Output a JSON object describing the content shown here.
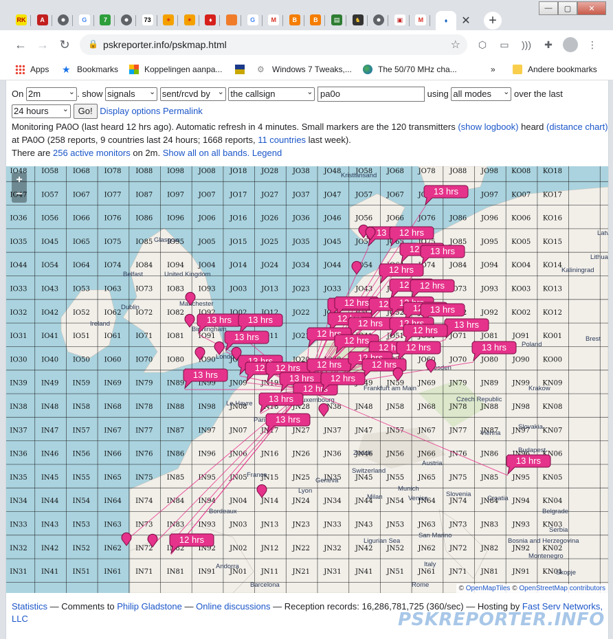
{
  "browser": {
    "url": "pskreporter.info/pskmap.html",
    "tabs": [
      {
        "icon": "rk-icon",
        "text": "RK",
        "color": "#f5e400",
        "fg": "#b00"
      },
      {
        "icon": "acrobat-icon",
        "text": "A",
        "color": "#c21f1f",
        "fg": "#fff"
      },
      {
        "icon": "globe-icon",
        "text": "",
        "color": "#5f6368",
        "fg": "#fff"
      },
      {
        "icon": "google-icon",
        "text": "G",
        "color": "#ffffff",
        "fg": "#4285f4"
      },
      {
        "icon": "seven-icon",
        "text": "7",
        "color": "#2e9e3a",
        "fg": "#fff"
      },
      {
        "icon": "globe-icon",
        "text": "",
        "color": "#5f6368",
        "fg": "#fff"
      },
      {
        "icon": "seventythree-icon",
        "text": "73",
        "color": "#ffffff",
        "fg": "#000"
      },
      {
        "icon": "joomla-icon",
        "text": "✶",
        "color": "#f4a100",
        "fg": "#d6201c"
      },
      {
        "icon": "joomla-icon",
        "text": "✶",
        "color": "#f4a100",
        "fg": "#d6201c"
      },
      {
        "icon": "antenna-icon",
        "text": "♦",
        "color": "#d6201c",
        "fg": "#fff"
      },
      {
        "icon": "orange-circle-icon",
        "text": "",
        "color": "#f07c2a",
        "fg": "#fff"
      },
      {
        "icon": "google-icon",
        "text": "G",
        "color": "#ffffff",
        "fg": "#4285f4"
      },
      {
        "icon": "gmail-icon",
        "text": "M",
        "color": "#ffffff",
        "fg": "#d93025"
      },
      {
        "icon": "blogger-icon",
        "text": "B",
        "color": "#f57d00",
        "fg": "#fff"
      },
      {
        "icon": "blogger-icon",
        "text": "B",
        "color": "#f57d00",
        "fg": "#fff"
      },
      {
        "icon": "radio-icon",
        "text": "▤",
        "color": "#2e7d32",
        "fg": "#fff"
      },
      {
        "icon": "shield-icon",
        "text": "♞",
        "color": "#333333",
        "fg": "#f4c430"
      },
      {
        "icon": "globe-icon",
        "text": "",
        "color": "#5f6368",
        "fg": "#fff"
      },
      {
        "icon": "qsl-icon",
        "text": "▣",
        "color": "#ffffff",
        "fg": "#c62828"
      },
      {
        "icon": "gmail-icon",
        "text": "M",
        "color": "#ffffff",
        "fg": "#d93025"
      },
      {
        "icon": "pskreporter-icon",
        "text": "♦",
        "color": "#ffffff",
        "fg": "#1565c0"
      }
    ],
    "bookmarks": [
      {
        "label": "Apps",
        "icon": "apps-grid-icon"
      },
      {
        "label": "Bookmarks",
        "icon": "star-icon"
      },
      {
        "label": "Koppelingen aanpa...",
        "icon": "windows-icon"
      },
      {
        "label": "",
        "icon": "flag-icon"
      },
      {
        "label": "Windows 7 Tweaks,...",
        "icon": "tweak-icon"
      },
      {
        "label": "The 50/70 MHz cha...",
        "icon": "earth-icon"
      },
      {
        "label": "Andere bookmarks",
        "icon": "folder-icon"
      }
    ],
    "bookmarks_more": "»"
  },
  "controls": {
    "on_label": "On",
    "band": "2m",
    "show_label": ". show",
    "what": "signals",
    "direction": "sent/rcvd by",
    "target_type": "the callsign",
    "callsign": "pa0o",
    "using_label": "using",
    "mode": "all modes",
    "over_label": "over the last",
    "period": "24 hours",
    "go": "Go!",
    "display_options": "Display options",
    "permalink": "Permalink"
  },
  "info": {
    "line1_a": "Monitoring PA0O (last heard 12 hrs ago). Automatic refresh in 4 minutes. Small markers are the 120 transmitters",
    "show_logbook": "(show logbook)",
    "line1_b": "heard",
    "distance_chart": "(distance chart)",
    "line2_a": "at PA0O (258 reports, 9 countries last 24 hours; 1668 reports,",
    "countries_link": "11 countries",
    "line2_b": "last week).",
    "line3_a": "There are",
    "monitors_link": "256 active monitors",
    "line3_b": "on 2m.",
    "show_all": "Show all on all bands.",
    "legend": "Legend"
  },
  "map": {
    "zoom_in": "+",
    "zoom_out": "−",
    "attribution_copy": "©",
    "openmaptiles": "OpenMapTiles",
    "attribution_sep": "©",
    "osm": "OpenStreetMap contributors",
    "grid_rows": [
      [
        "IO48",
        "IO58",
        "IO68",
        "IO78",
        "IO88",
        "IO98",
        "JO08",
        "JO18",
        "JO28",
        "JO38",
        "JO48",
        "JO58",
        "JO68",
        "JO78",
        "JO88",
        "JO98",
        "KO08",
        "KO18"
      ],
      [
        "IO47",
        "IO57",
        "IO67",
        "IO77",
        "IO87",
        "IO97",
        "JO07",
        "JO17",
        "JO27",
        "JO37",
        "JO47",
        "JO57",
        "JO67",
        "JO77",
        "JO87",
        "JO97",
        "KO07",
        "KO17"
      ],
      [
        "IO36",
        "IO56",
        "IO66",
        "IO76",
        "IO86",
        "IO96",
        "JO06",
        "JO16",
        "JO26",
        "JO36",
        "JO46",
        "JO56",
        "JO66",
        "JO76",
        "JO86",
        "JO96",
        "KO06",
        "KO16"
      ],
      [
        "IO35",
        "IO45",
        "IO65",
        "IO75",
        "IO85",
        "IO95",
        "JO05",
        "JO15",
        "JO25",
        "JO35",
        "JO45",
        "JO55",
        "JO65",
        "JO75",
        "JO85",
        "JO95",
        "KO05",
        "KO15"
      ],
      [
        "IO44",
        "IO54",
        "IO64",
        "IO74",
        "IO84",
        "IO94",
        "JO04",
        "JO14",
        "JO24",
        "JO34",
        "JO44",
        "JO54",
        "JO64",
        "JO74",
        "JO84",
        "JO94",
        "KO04",
        "KO14"
      ],
      [
        "IO33",
        "IO43",
        "IO53",
        "IO63",
        "IO73",
        "IO83",
        "IO93",
        "JO03",
        "JO13",
        "JO23",
        "JO33",
        "JO43",
        "JO53",
        "JO63",
        "JO73",
        "JO93",
        "KO03",
        "KO13"
      ],
      [
        "IO32",
        "IO42",
        "IO52",
        "IO62",
        "IO72",
        "IO82",
        "IO92",
        "JO02",
        "JO12",
        "JO22",
        "JO32",
        "JO42",
        "JO52",
        "JO62",
        "JO72",
        "JO92",
        "KO02",
        "KO12"
      ],
      [
        "IO31",
        "IO41",
        "IO51",
        "IO61",
        "IO71",
        "IO81",
        "IO91",
        "JO01",
        "JO11",
        "JO21",
        "JO31",
        "JO41",
        "JO51",
        "JO61",
        "JO71",
        "JO81",
        "JO91",
        "KO01"
      ],
      [
        "IO30",
        "IO40",
        "IO50",
        "IO60",
        "IO70",
        "IO80",
        "IO90",
        "JO00",
        "JO10",
        "JO20",
        "JO30",
        "JO40",
        "JO50",
        "JO60",
        "JO70",
        "JO80",
        "JO90",
        "KO00"
      ],
      [
        "IN39",
        "IN49",
        "IN59",
        "IN69",
        "IN79",
        "IN89",
        "IN99",
        "JN09",
        "JN19",
        "JN29",
        "JN39",
        "JN49",
        "JN59",
        "JN69",
        "JN79",
        "JN89",
        "JN99",
        "KN09"
      ],
      [
        "IN38",
        "IN48",
        "IN58",
        "IN68",
        "IN78",
        "IN88",
        "IN98",
        "JN08",
        "JN18",
        "JN28",
        "JN38",
        "JN48",
        "JN58",
        "JN68",
        "JN78",
        "JN88",
        "JN98",
        "KN08"
      ],
      [
        "IN37",
        "IN47",
        "IN57",
        "IN67",
        "IN77",
        "IN87",
        "IN97",
        "JN07",
        "JN17",
        "JN27",
        "JN37",
        "JN47",
        "JN57",
        "JN67",
        "JN77",
        "JN87",
        "JN97",
        "KN07"
      ],
      [
        "IN36",
        "IN46",
        "IN56",
        "IN66",
        "IN76",
        "IN86",
        "IN96",
        "JN06",
        "JN16",
        "JN26",
        "JN36",
        "JN46",
        "JN56",
        "JN66",
        "JN76",
        "JN86",
        "JN96",
        "KN06"
      ],
      [
        "IN35",
        "IN45",
        "IN55",
        "IN65",
        "IN75",
        "IN85",
        "IN95",
        "JN05",
        "JN15",
        "JN25",
        "JN35",
        "JN45",
        "JN55",
        "JN65",
        "JN75",
        "JN85",
        "JN95",
        "KN05"
      ],
      [
        "IN34",
        "IN44",
        "IN54",
        "IN64",
        "IN74",
        "IN84",
        "IN94",
        "JN04",
        "JN14",
        "JN24",
        "JN34",
        "JN44",
        "JN54",
        "JN64",
        "JN74",
        "JN84",
        "JN94",
        "KN04"
      ],
      [
        "IN33",
        "IN43",
        "IN53",
        "IN63",
        "IN73",
        "IN83",
        "IN93",
        "JN03",
        "JN13",
        "JN23",
        "JN33",
        "JN43",
        "JN53",
        "JN63",
        "JN73",
        "JN83",
        "JN93",
        "KN03"
      ],
      [
        "IN32",
        "IN42",
        "IN52",
        "IN62",
        "IN72",
        "IN82",
        "IN92",
        "JN02",
        "JN12",
        "JN22",
        "JN32",
        "JN42",
        "JN52",
        "JN62",
        "JN72",
        "JN82",
        "JN92",
        "KN02"
      ],
      [
        "IN31",
        "IN41",
        "IN51",
        "IN61",
        "IN71",
        "IN81",
        "IN91",
        "JN01",
        "JN11",
        "JN21",
        "JN31",
        "JN41",
        "JN51",
        "JN61",
        "JN71",
        "JN81",
        "JN91",
        "KN01"
      ]
    ],
    "place_labels": [
      "Kristiansand",
      "Glasgow",
      "United Kingdom",
      "Belfast",
      "Manchester",
      "Ireland",
      "Dublin",
      "Birmingham",
      "London",
      "Le Havre",
      "Paris",
      "Luxembourg",
      "Frankfurt am Main",
      "Dresden",
      "Czech Republic",
      "Krakow",
      "Lithuania",
      "Kaliningrad",
      "Poland",
      "Brest",
      "Vienna",
      "Budapest",
      "Hungary",
      "Slovakia",
      "Austria",
      "Munich",
      "Zurich",
      "Switzerland",
      "Geneva",
      "France",
      "Lyon",
      "Milan",
      "Venice",
      "Slovenia",
      "Croatia",
      "Bordeaux",
      "Belgrade",
      "Serbia",
      "Bosnia and Herzegovina",
      "Montenegro",
      "Skopje",
      "San Marino",
      "Italy",
      "Ligurian Sea",
      "Barcelona",
      "Rome",
      "Andorra",
      "Latvia"
    ],
    "marker_label": "13 hrs",
    "marker_label_alt": "12 hrs"
  },
  "footer": {
    "statistics": "Statistics",
    "comments": "— Comments to",
    "author": "Philip Gladstone",
    "dash": "—",
    "discussions": "Online discussions",
    "records": "— Reception records: 16,286,781,725 (360/sec) — Hosting by",
    "host": "Fast Serv Networks, LLC",
    "brand": "PSKREPORTER.INFO"
  }
}
